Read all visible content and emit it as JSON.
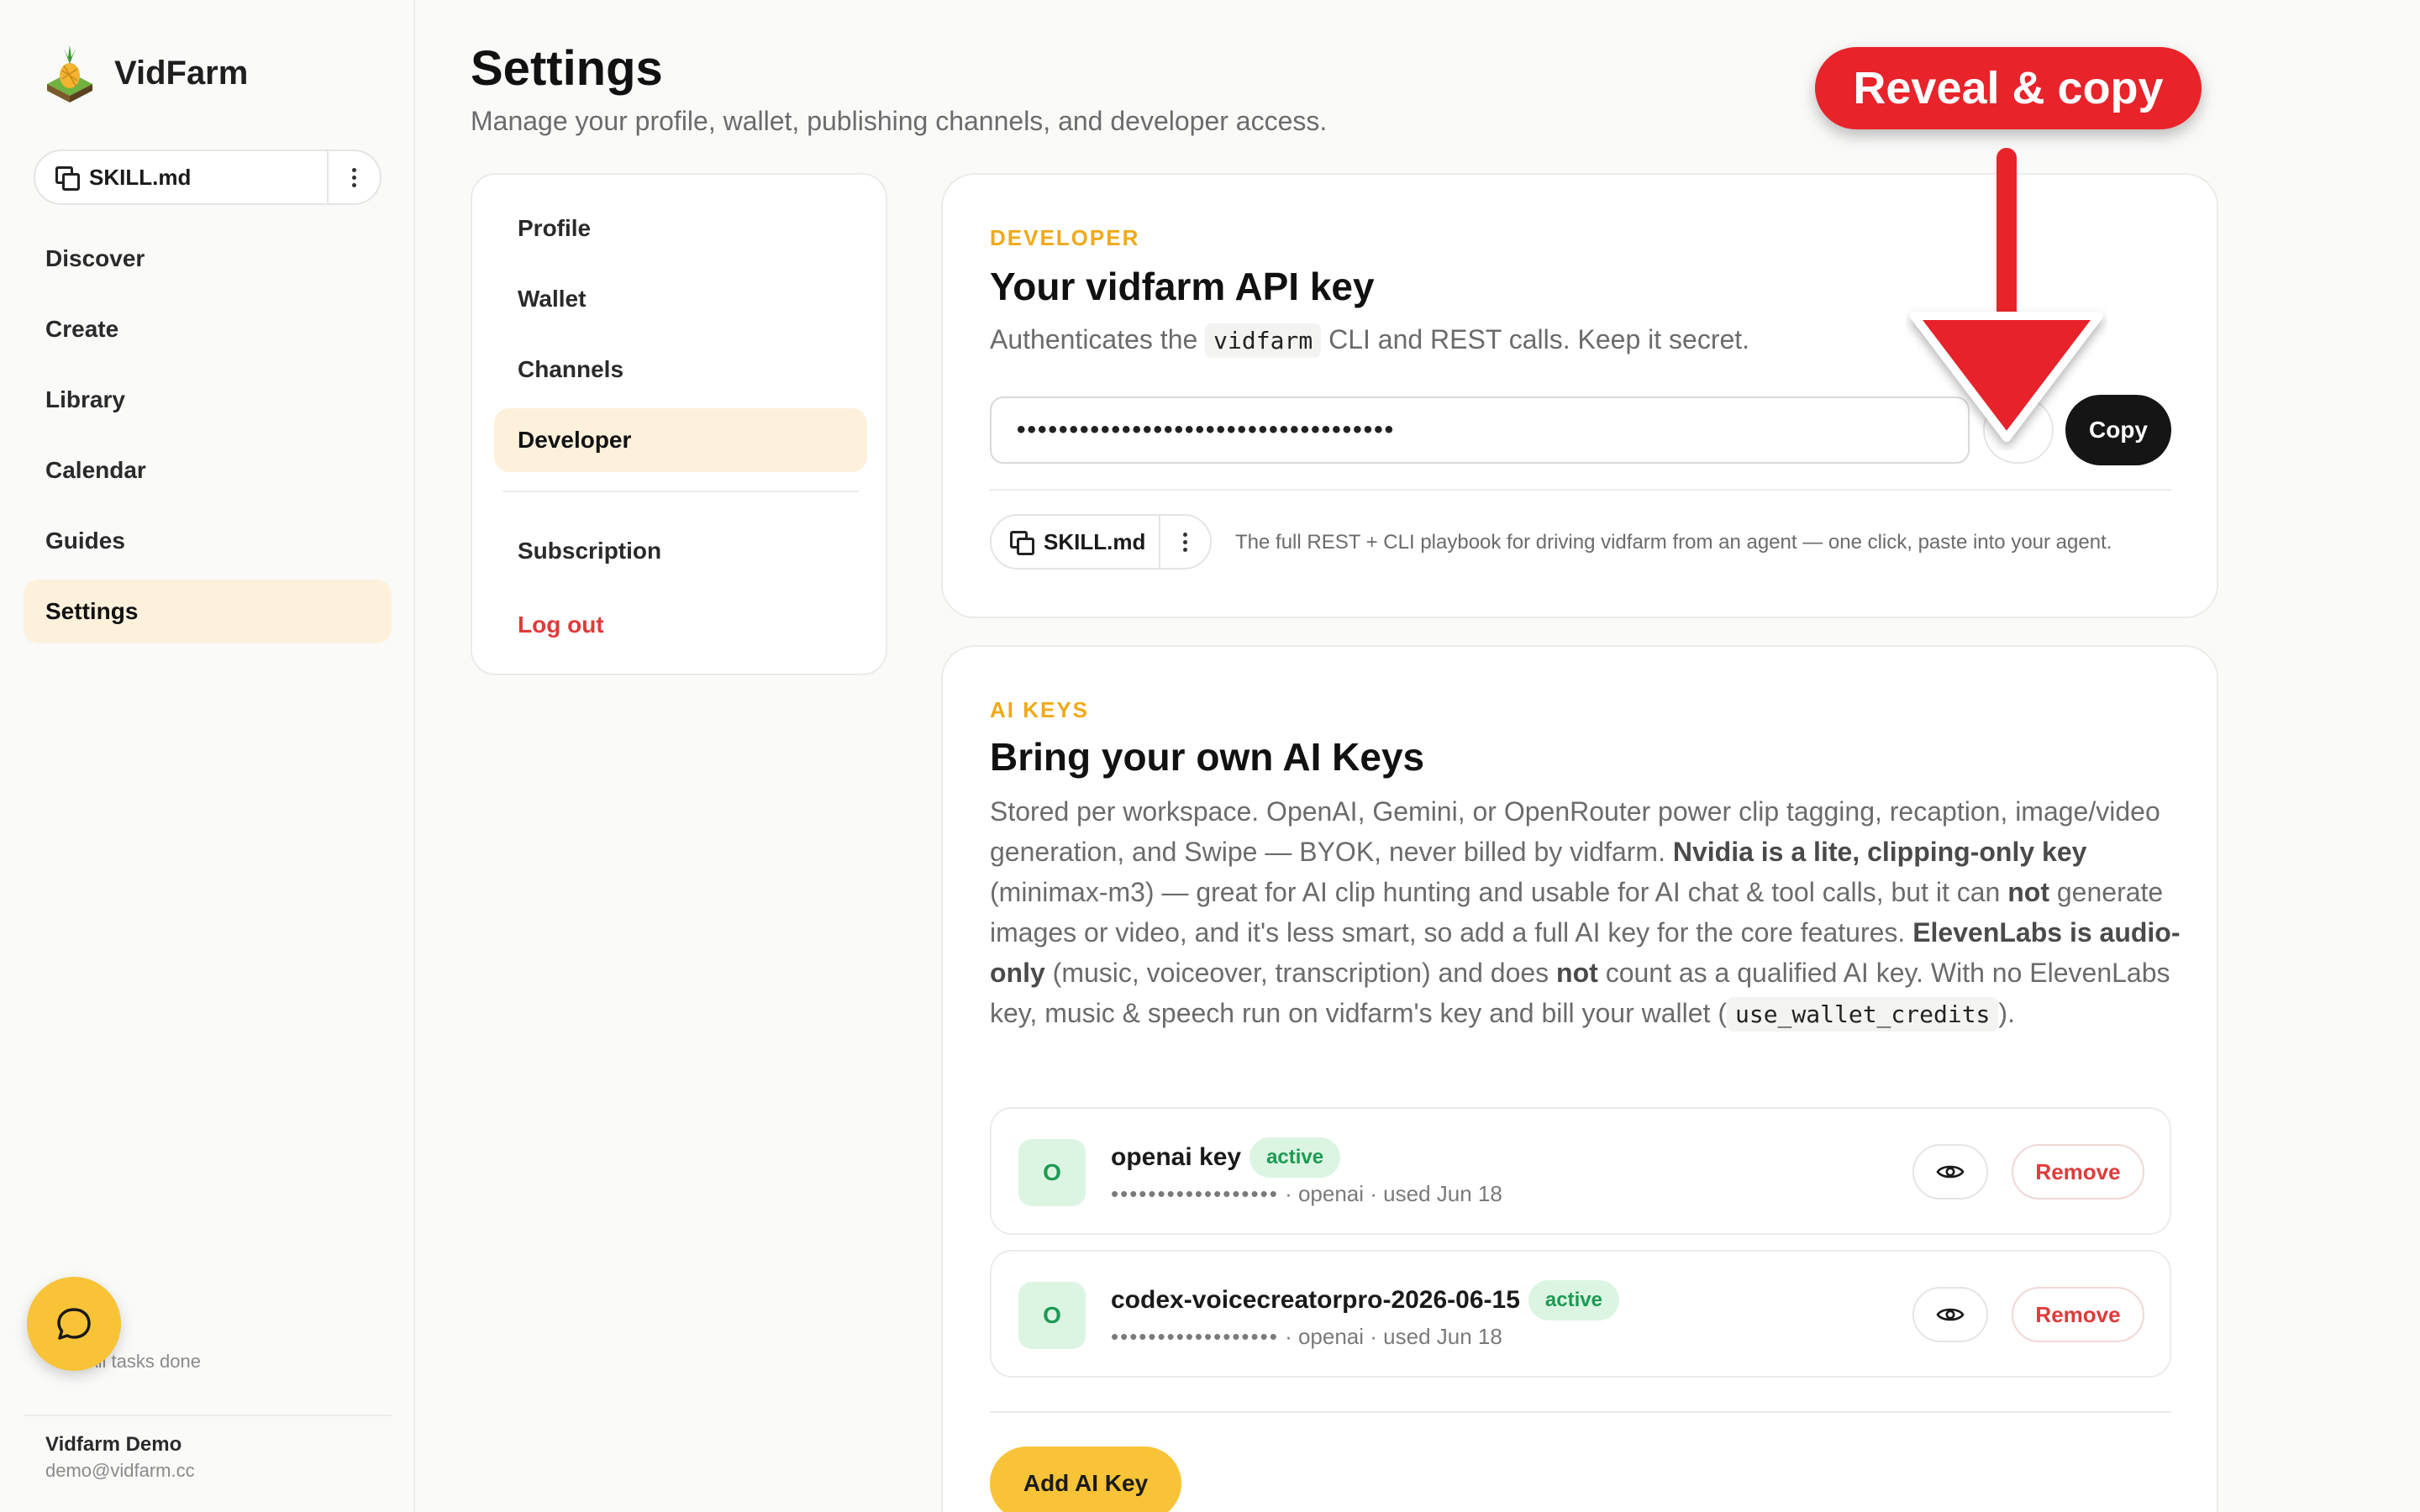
{
  "app": {
    "name": "VidFarm",
    "skill_file": "SKILL.md"
  },
  "sidebar": {
    "items": [
      {
        "label": "Discover"
      },
      {
        "label": "Create"
      },
      {
        "label": "Library"
      },
      {
        "label": "Calendar"
      },
      {
        "label": "Guides"
      },
      {
        "label": "Settings",
        "active": true
      }
    ],
    "tasks_status": "All tasks done",
    "user": {
      "name": "Vidfarm Demo",
      "email": "demo@vidfarm.cc"
    }
  },
  "header": {
    "title": "Settings",
    "subtitle": "Manage your profile, wallet, publishing channels, and developer access."
  },
  "settings_nav": {
    "items": [
      {
        "label": "Profile"
      },
      {
        "label": "Wallet"
      },
      {
        "label": "Channels"
      },
      {
        "label": "Developer",
        "active": true
      }
    ],
    "subscription": "Subscription",
    "logout": "Log out"
  },
  "developer": {
    "eyebrow": "DEVELOPER",
    "title": "Your vidfarm API key",
    "desc_prefix": "Authenticates the",
    "desc_code": "vidfarm",
    "desc_suffix": "CLI and REST calls. Keep it secret.",
    "masked_key": "••••••••••••••••••••••••••••••••••••",
    "copy_label": "Copy",
    "skill_label": "SKILL.md",
    "skill_note": "The full REST + CLI playbook for driving vidfarm from an agent — one click, paste into your agent."
  },
  "ai_keys": {
    "eyebrow": "AI KEYS",
    "title": "Bring your own AI Keys",
    "desc": {
      "p1": "Stored per workspace. OpenAI, Gemini, or OpenRouter power clip tagging, recaption, image/video generation, and Swipe — BYOK, never billed by vidfarm. ",
      "b1": "Nvidia is a lite, clipping-only key",
      "p2": " (minimax-m3) — great for AI clip hunting and usable for AI chat & tool calls, but it can ",
      "b2": "not",
      "p3": " generate images or video, and it's less smart, so add a full AI key for the core features. ",
      "b3": "ElevenLabs is audio-only",
      "p4": " (music, voiceover, transcription) and does ",
      "b4": "not",
      "p5": " count as a qualified AI key. With no ElevenLabs key, music & speech run on vidfarm's key and bill your wallet (",
      "code": "use_wallet_credits",
      "p6": ")."
    },
    "keys": [
      {
        "initial": "O",
        "name": "openai key",
        "status": "active",
        "mask": "••••••••••••••••••",
        "meta": " · openai · used Jun 18",
        "remove": "Remove"
      },
      {
        "initial": "O",
        "name": "codex-voicecreatorpro-2026-06-15",
        "status": "active",
        "mask": "••••••••••••••••••",
        "meta": " · openai · used Jun 18",
        "remove": "Remove"
      }
    ],
    "add_label": "Add AI Key"
  },
  "annotation": {
    "callout": "Reveal & copy",
    "color": "#e8232a"
  }
}
